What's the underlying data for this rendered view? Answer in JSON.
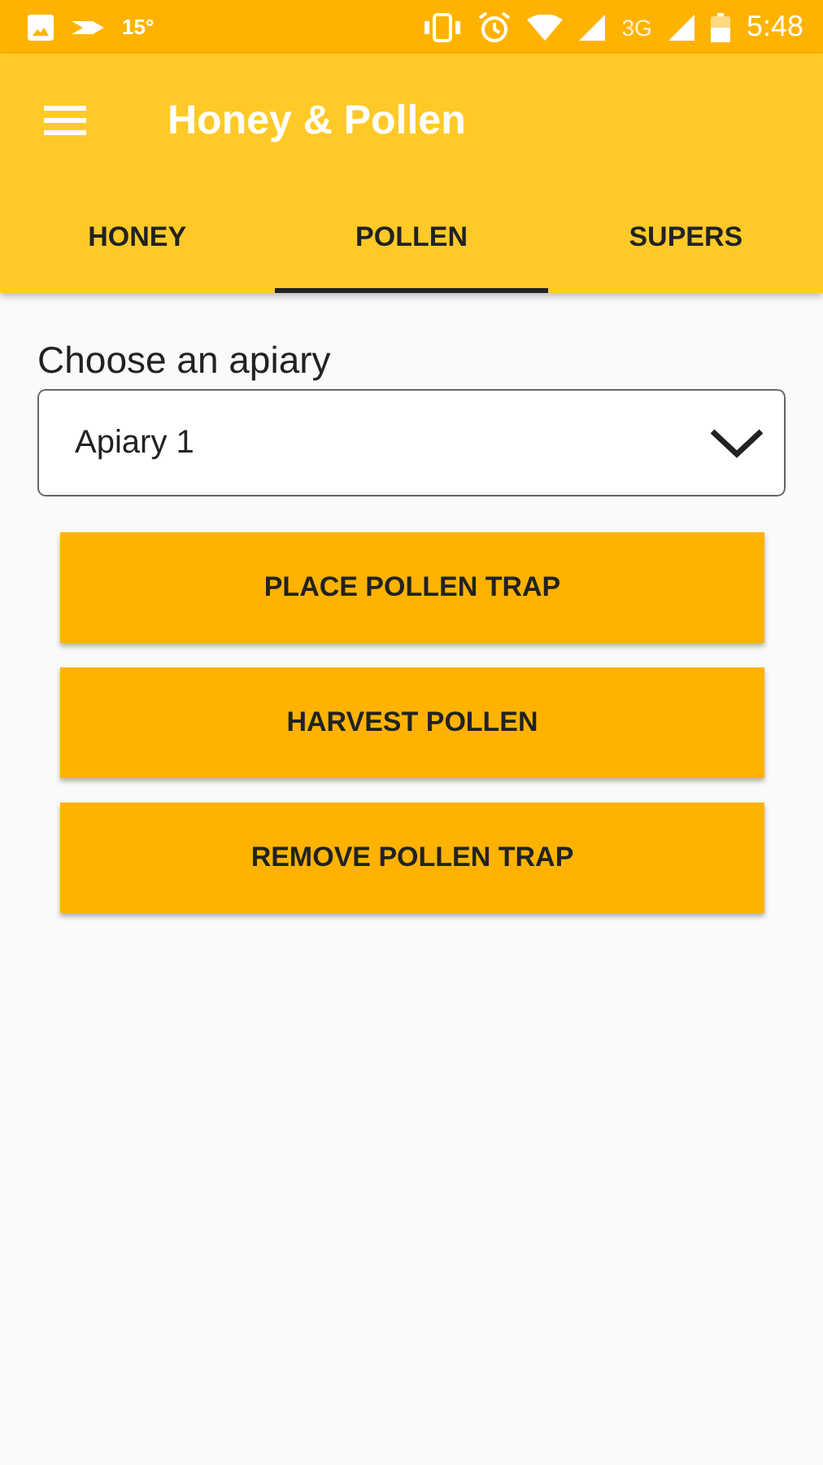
{
  "status_bar": {
    "temperature": "15°",
    "network": "3G",
    "time": "5:48"
  },
  "app_bar": {
    "title": "Honey & Pollen"
  },
  "tabs": [
    {
      "label": "HONEY",
      "selected": false
    },
    {
      "label": "POLLEN",
      "selected": true
    },
    {
      "label": "SUPERS",
      "selected": false
    }
  ],
  "apiary": {
    "label": "Choose an apiary",
    "value": "Apiary 1"
  },
  "buttons": [
    "PLACE POLLEN TRAP",
    "HARVEST POLLEN",
    "REMOVE POLLEN TRAP"
  ]
}
